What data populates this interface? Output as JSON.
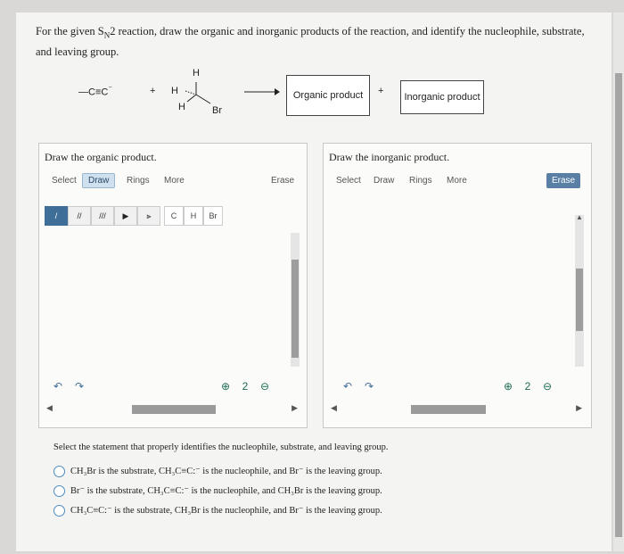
{
  "question": {
    "prefix": "For the given S",
    "sub": "N",
    "suffix": "2 reaction, draw the organic and inorganic products of the reaction, and identify the nucleophile, substrate, and leaving group."
  },
  "scheme": {
    "nucleophile": "—C≡C",
    "charge": "⁻",
    "plus1": "+",
    "h_top": "H",
    "h_left": "H",
    "h_bottom": "H",
    "br": "Br",
    "organic_product": "Organic product",
    "plus2": "+",
    "inorganic_product": "Inorganic product"
  },
  "panel_left": {
    "title": "Draw the organic product.",
    "toolbar": [
      "Select",
      "Draw",
      "Rings",
      "More"
    ],
    "erase": "Erase",
    "tools": [
      "/",
      "//",
      "///",
      "▶",
      "⫸"
    ],
    "atoms": [
      "C",
      "H",
      "Br"
    ]
  },
  "panel_right": {
    "title": "Draw the inorganic product.",
    "toolbar": [
      "Select",
      "Draw",
      "Rings",
      "More"
    ],
    "erase": "Erase"
  },
  "icons": {
    "undo": "↶",
    "redo": "↷",
    "zoom_in": "⊕",
    "zoom_reset": "2",
    "zoom_out": "⊖"
  },
  "mc": {
    "prompt": "Select the statement that properly identifies the nucleophile, substrate, and leaving group.",
    "options": [
      "CH₃Br is the substrate, CH₃C≡C:⁻ is the nucleophile, and Br⁻ is the leaving group.",
      "Br⁻ is the substrate, CH₃C≡C:⁻ is the nucleophile, and CH₃Br is the leaving group.",
      "CH₃C≡C:⁻ is the substrate, CH₃Br is the nucleophile, and Br⁻ is the leaving group."
    ]
  },
  "colors": {
    "accent": "#3f6e98",
    "radio": "#4d8bc0"
  }
}
